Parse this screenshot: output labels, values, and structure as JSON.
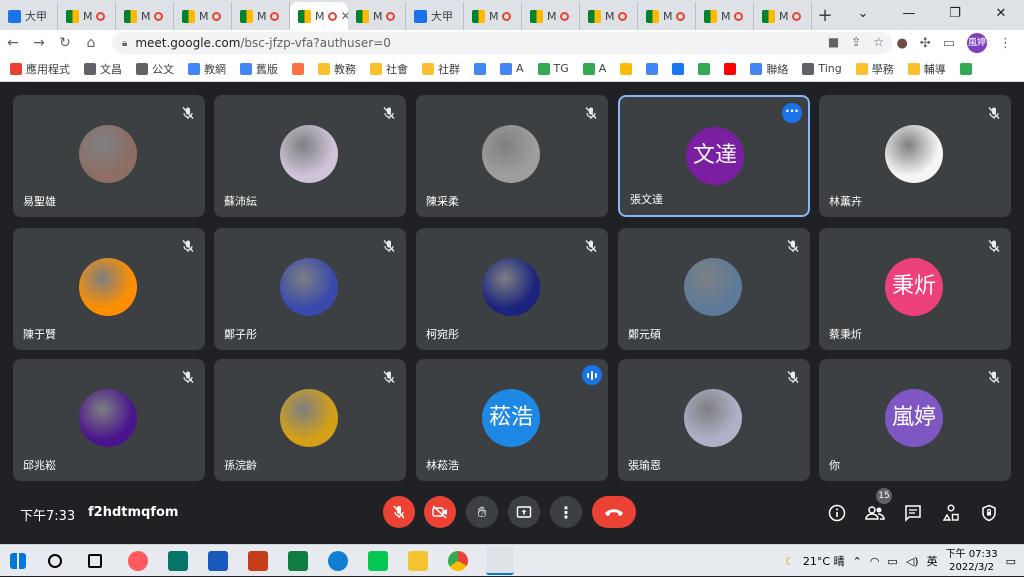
{
  "browser": {
    "tabs": [
      {
        "label": "大甲",
        "type": "cal"
      },
      {
        "label": "M",
        "type": "meet"
      },
      {
        "label": "M",
        "type": "meet"
      },
      {
        "label": "M",
        "type": "meet"
      },
      {
        "label": "M",
        "type": "meet"
      },
      {
        "label": "M",
        "type": "meet",
        "active": true
      },
      {
        "label": "M",
        "type": "meet"
      },
      {
        "label": "大甲",
        "type": "cal"
      },
      {
        "label": "M",
        "type": "meet"
      },
      {
        "label": "M",
        "type": "meet"
      },
      {
        "label": "M",
        "type": "meet"
      },
      {
        "label": "M",
        "type": "meet"
      },
      {
        "label": "M",
        "type": "meet"
      },
      {
        "label": "M",
        "type": "meet"
      }
    ],
    "url_host": "meet.google.com",
    "url_path": "/bsc-jfzp-vfa?authuser=0",
    "profile_initials": "嵐婷",
    "bookmarks": [
      {
        "label": "應用程式",
        "color": "#ea4335"
      },
      {
        "label": "文昌",
        "color": "#5f6368"
      },
      {
        "label": "公文",
        "color": "#5f6368"
      },
      {
        "label": "教網",
        "color": "#4285f4"
      },
      {
        "label": "舊版",
        "color": "#4285f4"
      },
      {
        "label": "",
        "color": "#ff7043"
      },
      {
        "label": "教務",
        "color": "#fbc02d"
      },
      {
        "label": "社會",
        "color": "#fbc02d"
      },
      {
        "label": "社群",
        "color": "#fbc02d"
      },
      {
        "label": "",
        "color": "#4285f4"
      },
      {
        "label": "A",
        "color": "#4285f4"
      },
      {
        "label": "TG",
        "color": "#34a853"
      },
      {
        "label": "A",
        "color": "#34a853"
      },
      {
        "label": "",
        "color": "#fbbc04"
      },
      {
        "label": "",
        "color": "#4285f4"
      },
      {
        "label": "",
        "color": "#1877f2"
      },
      {
        "label": "",
        "color": "#34a853"
      },
      {
        "label": "",
        "color": "#ff0000"
      },
      {
        "label": "聯絡",
        "color": "#4285f4"
      },
      {
        "label": "Ting",
        "color": "#5f6368"
      },
      {
        "label": "學務",
        "color": "#fbc02d"
      },
      {
        "label": "輔導",
        "color": "#fbc02d"
      },
      {
        "label": "",
        "color": "#34a853"
      }
    ]
  },
  "participants": [
    {
      "name": "易聖雄",
      "avatar": "cat",
      "color": "#8d6e63",
      "muted": true
    },
    {
      "name": "蘇沛紜",
      "avatar": "anime-girl",
      "color": "#cfc4d8",
      "muted": true
    },
    {
      "name": "陳采柔",
      "avatar": "boy-photo",
      "color": "#9e9e9e",
      "muted": true
    },
    {
      "name": "張文達",
      "initials": "文達",
      "color": "#7b1fa2",
      "active": true,
      "more": true
    },
    {
      "name": "林薰卉",
      "avatar": "bear-sticker",
      "color": "#f5f5f5",
      "muted": true
    },
    {
      "name": "陳于賢",
      "avatar": "fireball",
      "color": "#ff8f00",
      "muted": true
    },
    {
      "name": "鄭子彤",
      "avatar": "police-girl",
      "color": "#3949ab",
      "muted": true
    },
    {
      "name": "柯宛彤",
      "avatar": "anime-flowers",
      "color": "#1a237e",
      "muted": true
    },
    {
      "name": "鄭元碩",
      "avatar": "car",
      "color": "#5d7a99",
      "muted": true
    },
    {
      "name": "蔡秉炘",
      "initials": "秉炘",
      "color": "#ec407a",
      "muted": true
    },
    {
      "name": "邱兆崧",
      "avatar": "purple-dragon",
      "color": "#4a148c",
      "muted": true
    },
    {
      "name": "孫浣齡",
      "avatar": "woman-photo",
      "color": "#d4a017",
      "muted": true
    },
    {
      "name": "林菘浩",
      "initials": "菘浩",
      "color": "#1e88e5",
      "speaking": true
    },
    {
      "name": "張瑜恩",
      "avatar": "anime-white",
      "color": "#b0b0c8",
      "muted": true
    },
    {
      "name": "你",
      "initials": "嵐婷",
      "color": "#7e57c2",
      "muted": true
    }
  ],
  "controls": {
    "time": "下午7:33",
    "meeting_code": "f2hdtmqfom",
    "participant_count": "15"
  },
  "taskbar": {
    "weather": "21°C 晴",
    "ime": "英",
    "time": "下午 07:33",
    "date": "2022/3/2"
  }
}
